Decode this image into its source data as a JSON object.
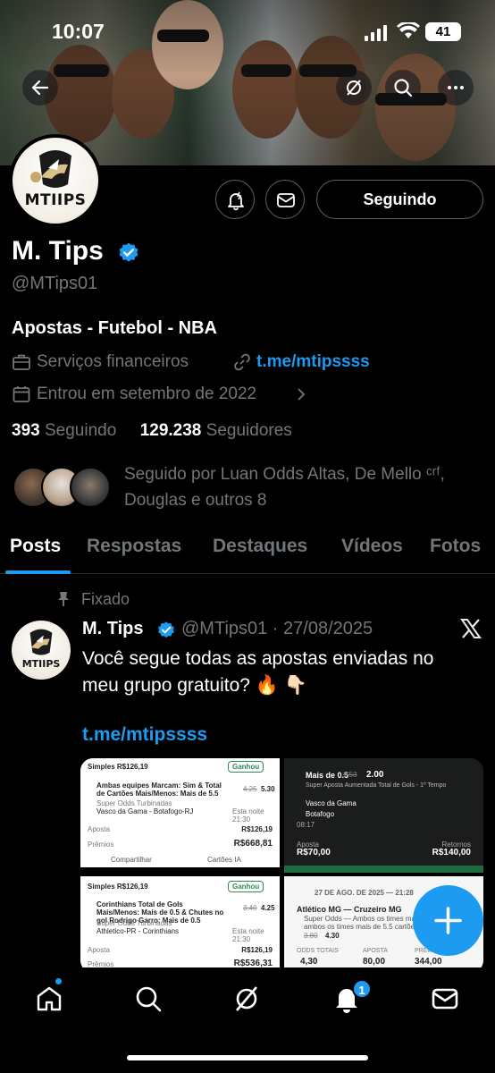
{
  "status_bar": {
    "time": "10:07",
    "battery": "41"
  },
  "profile": {
    "name": "M. Tips",
    "handle": "@MTips01",
    "avatar_logo": "MTIIPS",
    "follow_button": "Seguindo",
    "bio": "Apostas - Futebol - NBA",
    "category": "Serviços financeiros",
    "website": "t.me/mtipssss",
    "joined": "Entrou em setembro de 2022",
    "following_count": "393",
    "following_label": "Seguindo",
    "followers_count": "129.238",
    "followers_label": "Seguidores",
    "followed_by": "Seguido por Luan Odds Altas, De Mello ᶜʳᶠ, Douglas e outros 8"
  },
  "tabs": [
    "Posts",
    "Respostas",
    "Destaques",
    "Vídeos",
    "Fotos"
  ],
  "pinned_post": {
    "pinned_label": "Fixado",
    "author_name": "M. Tips",
    "author_handle_date": "@MTips01 · 27/08/2025",
    "text": "Você segue todas as apostas enviadas no meu grupo gratuito? 🔥 👇🏻",
    "link": "t.me/mtipssss",
    "images": {
      "card1": {
        "header": "Simples  R$126,19",
        "status": "Ganhou",
        "title": "Ambas equipes Marcam: Sim & Total de Cartões Mais/Menos: Mais de 5.5",
        "odds_old": "4.25",
        "odds": "5.30",
        "sub": "Super Odds Turbinadas",
        "match": "Vasco da Gama - Botafogo-RJ",
        "time": "Esta noite 21:30",
        "stake_label": "Aposta",
        "stake": "R$126,19",
        "prize_label": "Prêmios",
        "prize": "R$668,81",
        "share": "Compartilhar",
        "cards": "Cartões IA"
      },
      "card2": {
        "header": "Simples  R$126,19",
        "status": "Ganhou",
        "title": "Corinthians Total de Gols Mais/Menos: Mais de 0.5 & Chutes no gol Rodrigo Garro: Mais de 0.5",
        "odds_old": "3.40",
        "odds": "4.25",
        "sub": "Super Odds Turbinadas",
        "match": "Athletico-PR - Corinthians",
        "time": "Esta noite 21:30",
        "stake_label": "Aposta",
        "stake": "R$126,19",
        "prize_label": "Prêmios",
        "prize": "R$536,31"
      },
      "card3": {
        "title": "Mais de 0.5",
        "odds_old": "1.53",
        "odds": "2.00",
        "sub": "Super Aposta Aumentada",
        "market": "Total de Gols - 1º Tempo",
        "team1": "Vasco da Gama",
        "team2": "Botafogo",
        "clock": "08:17",
        "stake_label": "Aposta",
        "stake": "R$70,00",
        "return_label": "Retornos",
        "return": "R$140,00"
      },
      "card4": {
        "date": "27 DE AGO. DE 2025 — 21:28",
        "match": "Atlético MG — Cruzeiro MG",
        "desc": "Super Odds — Ambos os times marcam e ambos os times mais de 5.5 cartões",
        "odds_old": "3.80",
        "odds": "4.30",
        "col1": "ODDS TOTAIS",
        "col2": "APOSTA",
        "col3": "PRÊMIO",
        "v1": "4,30",
        "v2": "80,00",
        "v3": "344,00"
      }
    }
  },
  "bottom_nav": {
    "notifications_badge": "1"
  },
  "icons": [
    "back-arrow-icon",
    "grok-icon",
    "search-icon",
    "more-icon",
    "notify-bell-icon",
    "message-icon",
    "verified-badge-icon",
    "briefcase-icon",
    "link-icon",
    "calendar-icon",
    "chevron-right-icon",
    "pin-icon",
    "x-logo-icon",
    "plus-icon",
    "home-icon",
    "explore-icon",
    "bell-icon",
    "mail-icon"
  ],
  "colors": {
    "accent": "#1d9bf0",
    "background": "#000000",
    "muted": "#71767b",
    "text": "#e7e9ea"
  }
}
